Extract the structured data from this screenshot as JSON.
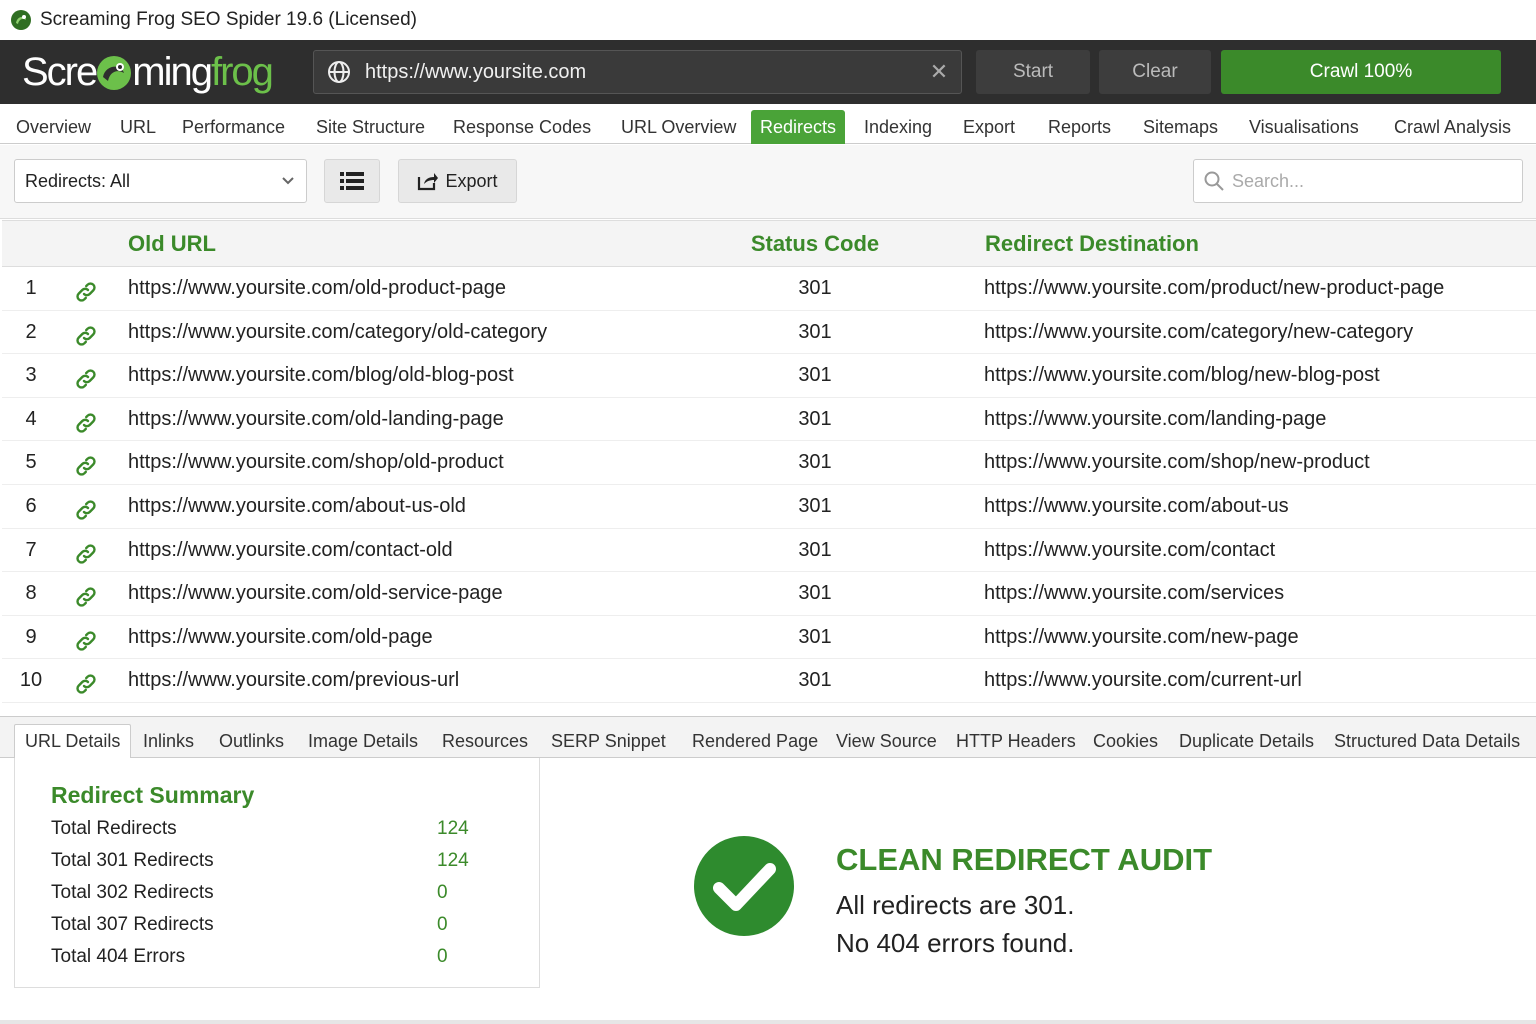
{
  "window": {
    "title": "Screaming Frog SEO Spider 19.6 (Licensed)"
  },
  "toolbar": {
    "logo_part1": "Scre",
    "logo_part2": "ming",
    "logo_part3": "frog",
    "url_value": "https://www.yoursite.com",
    "start_label": "Start",
    "clear_label": "Clear",
    "crawl_label": "Crawl 100%",
    "crawl_progress": 100
  },
  "tabs": [
    "Overview",
    "URL",
    "Performance",
    "Site Structure",
    "Response Codes",
    "URL Overview",
    "Redirects",
    "Indexing",
    "Export",
    "Reports",
    "Sitemaps",
    "Visualisations",
    "Crawl Analysis"
  ],
  "active_tab": "Redirects",
  "filter": {
    "select_value": "Redirects: All",
    "export_label": "Export",
    "search_placeholder": "Search..."
  },
  "table": {
    "columns": [
      "Old URL",
      "Status Code",
      "Redirect Destination"
    ],
    "rows": [
      {
        "n": "1",
        "old": "https://www.yoursite.com/old-product-page",
        "code": "301",
        "dest": "https://www.yoursite.com/product/new-product-page"
      },
      {
        "n": "2",
        "old": "https://www.yoursite.com/category/old-category",
        "code": "301",
        "dest": "https://www.yoursite.com/category/new-category"
      },
      {
        "n": "3",
        "old": "https://www.yoursite.com/blog/old-blog-post",
        "code": "301",
        "dest": "https://www.yoursite.com/blog/new-blog-post"
      },
      {
        "n": "4",
        "old": "https://www.yoursite.com/old-landing-page",
        "code": "301",
        "dest": "https://www.yoursite.com/landing-page"
      },
      {
        "n": "5",
        "old": "https://www.yoursite.com/shop/old-product",
        "code": "301",
        "dest": "https://www.yoursite.com/shop/new-product"
      },
      {
        "n": "6",
        "old": "https://www.yoursite.com/about-us-old",
        "code": "301",
        "dest": "https://www.yoursite.com/about-us"
      },
      {
        "n": "7",
        "old": "https://www.yoursite.com/contact-old",
        "code": "301",
        "dest": "https://www.yoursite.com/contact"
      },
      {
        "n": "8",
        "old": "https://www.yoursite.com/old-service-page",
        "code": "301",
        "dest": "https://www.yoursite.com/services"
      },
      {
        "n": "9",
        "old": "https://www.yoursite.com/old-page",
        "code": "301",
        "dest": "https://www.yoursite.com/new-page"
      },
      {
        "n": "10",
        "old": "https://www.yoursite.com/previous-url",
        "code": "301",
        "dest": "https://www.yoursite.com/current-url"
      }
    ]
  },
  "bottom_tabs": [
    "URL Details",
    "Inlinks",
    "Outlinks",
    "Image Details",
    "Resources",
    "SERP Snippet",
    "Rendered Page",
    "View Source",
    "HTTP Headers",
    "Cookies",
    "Duplicate Details",
    "Structured Data Details"
  ],
  "active_bottom_tab": "URL Details",
  "summary": {
    "title": "Redirect Summary",
    "items": [
      {
        "label": "Total Redirects",
        "value": "124"
      },
      {
        "label": "Total 301 Redirects",
        "value": "124"
      },
      {
        "label": "Total 302 Redirects",
        "value": "0"
      },
      {
        "label": "Total 307 Redirects",
        "value": "0"
      },
      {
        "label": "Total 404 Errors",
        "value": "0"
      }
    ]
  },
  "audit": {
    "heading": "CLEAN REDIRECT AUDIT",
    "line1": "All redirects are 301.",
    "line2": "No 404 errors found."
  },
  "colors": {
    "accent_green": "#3b8a2a",
    "tab_active_green": "#4aa338",
    "toolbar_bg": "#2e2e2e",
    "logo_green": "#6cc04a"
  },
  "icons": {
    "app": "frog-icon",
    "url": "globe-icon",
    "clear_url": "close-icon",
    "filter": "chevron-down-icon",
    "view": "list-icon",
    "export": "export-icon",
    "search": "search-icon",
    "row": "link-icon",
    "audit": "check-circle-icon"
  }
}
